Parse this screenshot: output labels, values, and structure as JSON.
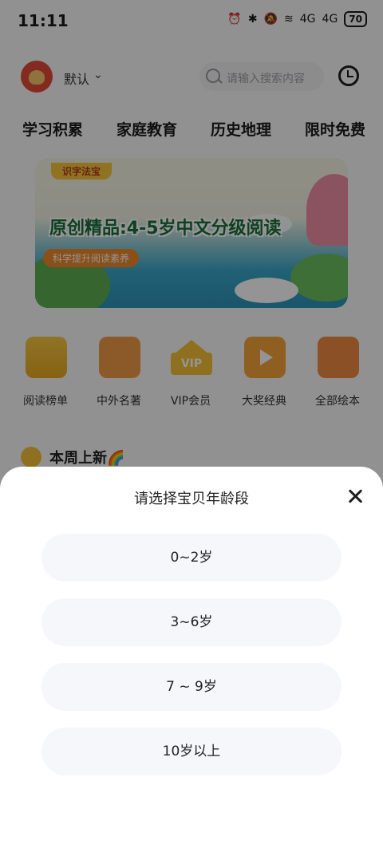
{
  "status_bar": {
    "time": "11:11",
    "icons": [
      "alarm-icon",
      "bluetooth-icon",
      "mute-icon",
      "wifi-icon",
      "signal-4g-icon",
      "signal-4g-icon"
    ],
    "signal_labels": [
      "4G",
      "4G"
    ],
    "battery": "70"
  },
  "header": {
    "profile_label": "默认",
    "search_placeholder": "请输入搜索内容"
  },
  "tabs": [
    "学习积累",
    "家庭教育",
    "历史地理",
    "限时免费"
  ],
  "banner": {
    "tag": "识字法宝",
    "title": "原创精品:4-5岁中文分级阅读",
    "subtitle": "科学提升阅读素养"
  },
  "categories": [
    {
      "label": "阅读榜单",
      "icon": "podium-icon"
    },
    {
      "label": "中外名著",
      "icon": "book-icon"
    },
    {
      "label": "VIP会员",
      "icon": "vip-crown-icon"
    },
    {
      "label": "大奖经典",
      "icon": "medal-icon"
    },
    {
      "label": "全部绘本",
      "icon": "wallet-icon"
    }
  ],
  "section": {
    "title": "本周上新🌈"
  },
  "sheet": {
    "title": "请选择宝贝年龄段",
    "options": [
      "0~2岁",
      "3~6岁",
      "7 ~ 9岁",
      "10岁以上"
    ]
  },
  "colors": {
    "overlay": "rgba(0,0,0,0.42)",
    "sheet_bg": "#ffffff",
    "option_bg": "#f5f7fb",
    "accent_yellow": "#f6c238"
  }
}
